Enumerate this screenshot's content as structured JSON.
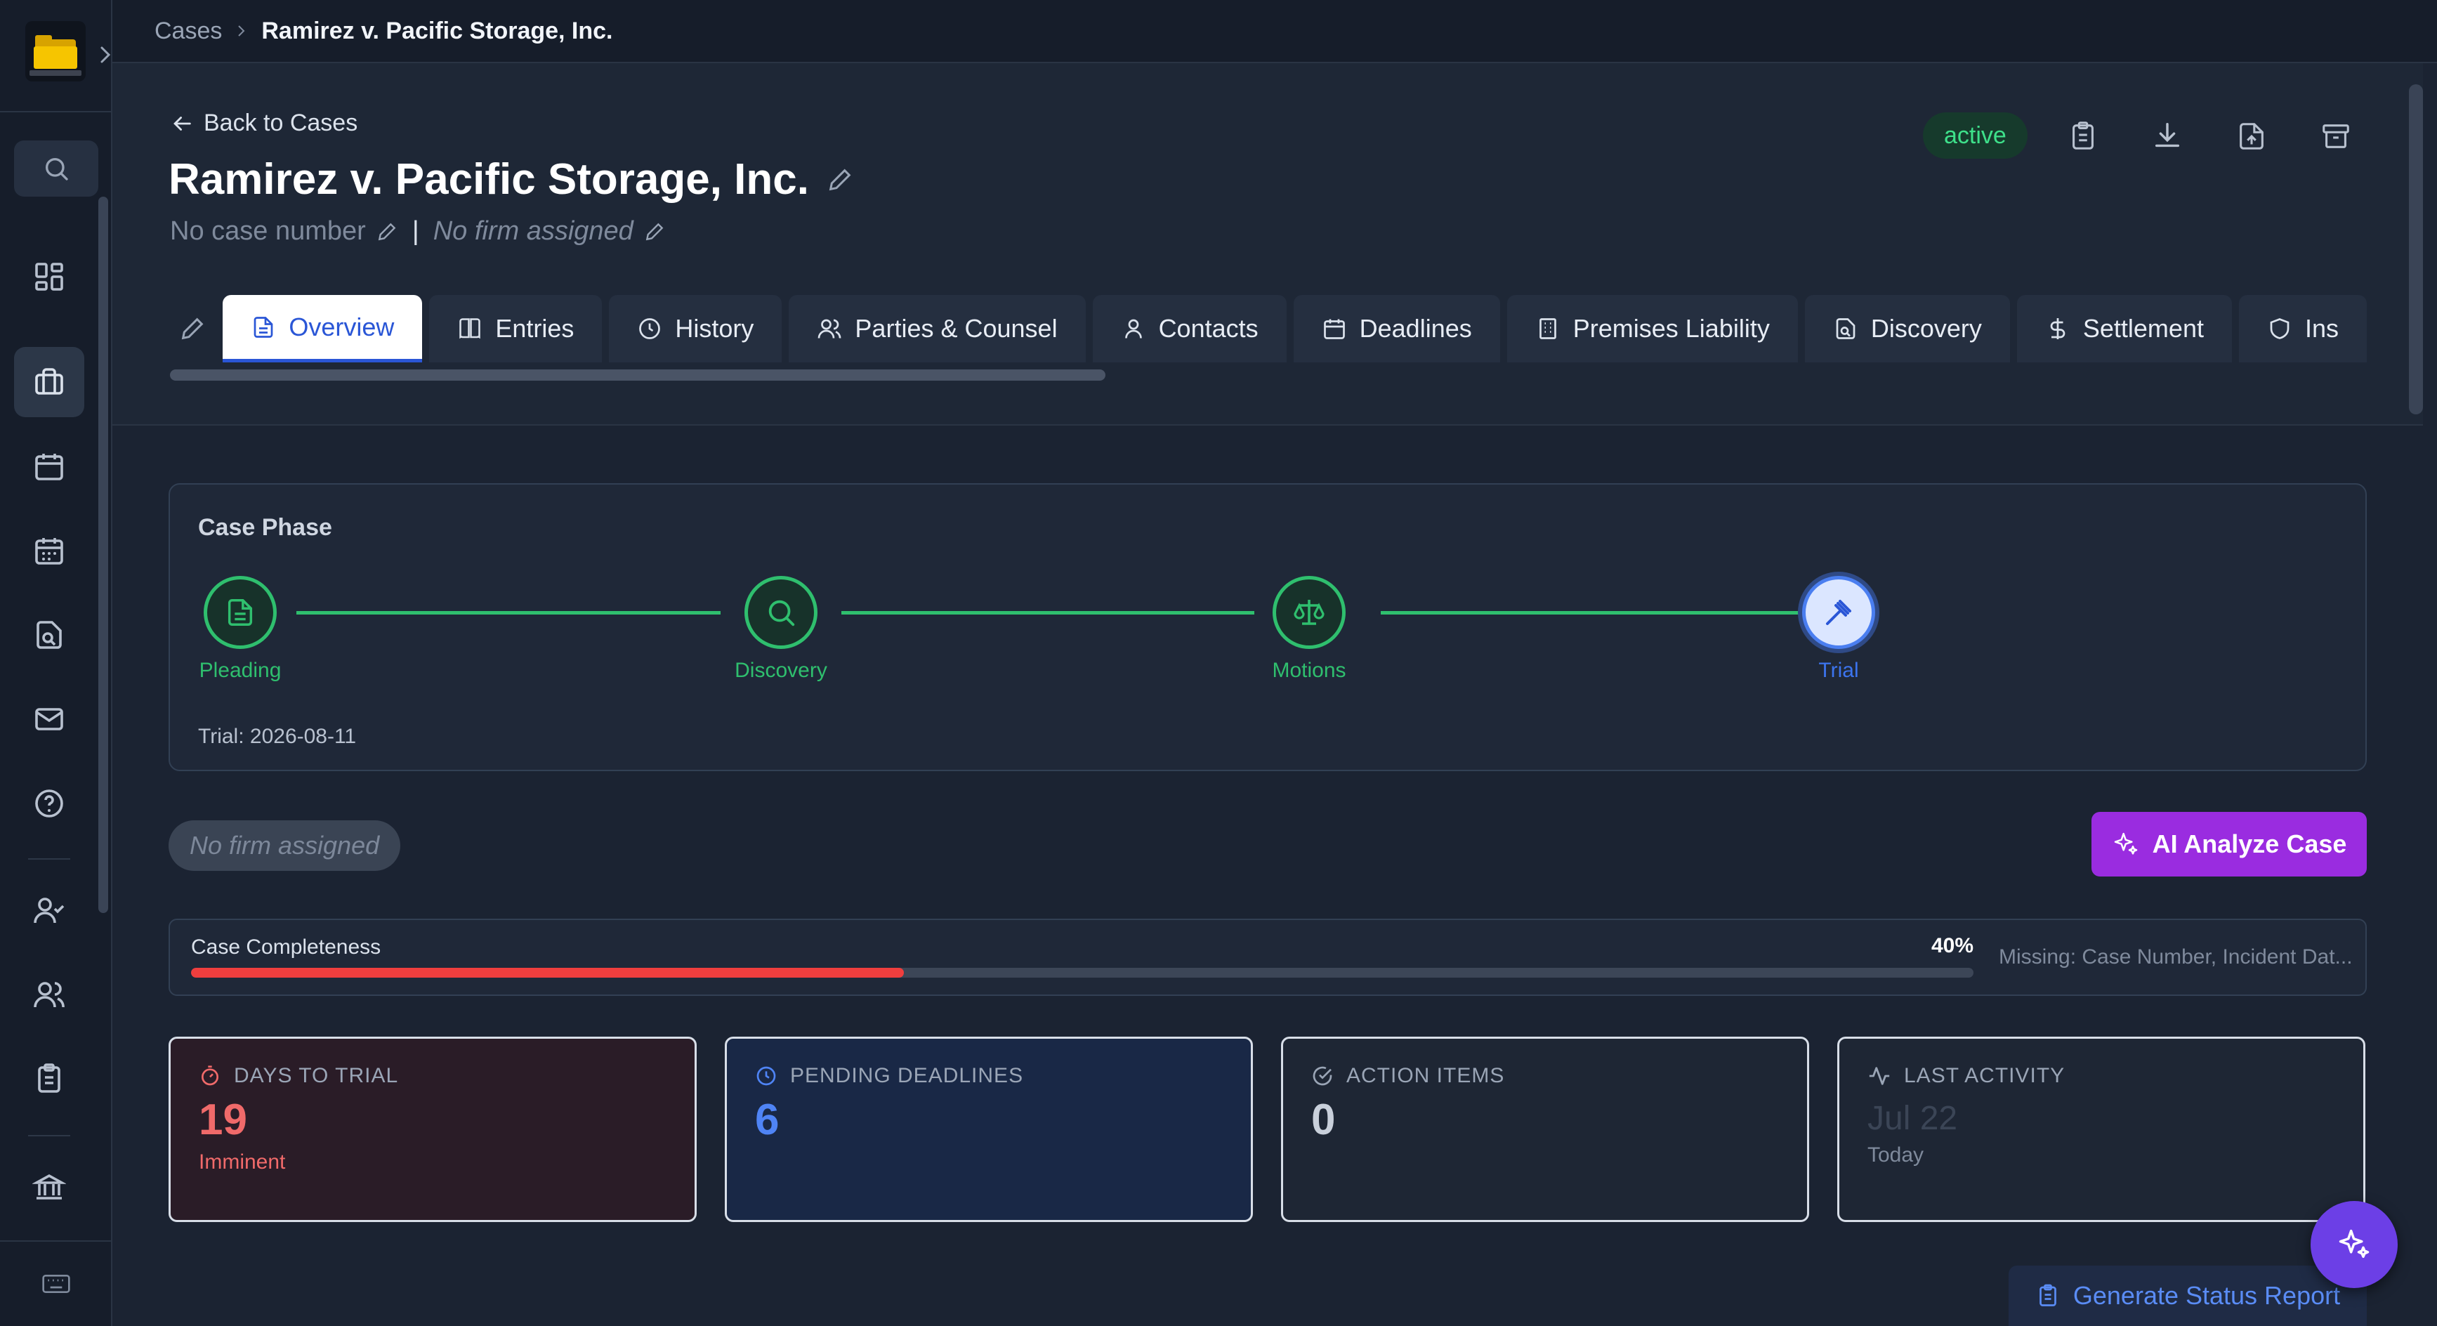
{
  "breadcrumb": {
    "root": "Cases",
    "current": "Ramirez v. Pacific Storage, Inc."
  },
  "header": {
    "back_label": "Back to Cases",
    "title": "Ramirez v. Pacific Storage, Inc.",
    "case_number": "No case number",
    "firm": "No firm assigned",
    "status": "active"
  },
  "tabs": [
    {
      "label": "Overview",
      "icon": "document-icon",
      "active": true
    },
    {
      "label": "Entries",
      "icon": "book-icon"
    },
    {
      "label": "History",
      "icon": "clock-icon"
    },
    {
      "label": "Parties & Counsel",
      "icon": "users-icon"
    },
    {
      "label": "Contacts",
      "icon": "user-icon"
    },
    {
      "label": "Deadlines",
      "icon": "calendar-icon"
    },
    {
      "label": "Premises Liability",
      "icon": "building-icon"
    },
    {
      "label": "Discovery",
      "icon": "file-search-icon"
    },
    {
      "label": "Settlement",
      "icon": "dollar-icon"
    },
    {
      "label": "Ins",
      "icon": "shield-icon"
    }
  ],
  "phase": {
    "title": "Case Phase",
    "steps": [
      {
        "label": "Pleading",
        "icon": "document-icon"
      },
      {
        "label": "Discovery",
        "icon": "search-icon"
      },
      {
        "label": "Motions",
        "icon": "scale-icon"
      },
      {
        "label": "Trial",
        "icon": "gavel-icon",
        "current": true
      }
    ],
    "trial_date": "Trial: 2026-08-11"
  },
  "firm_badge": "No firm assigned",
  "ai_button": "AI Analyze Case",
  "completeness": {
    "label": "Case Completeness",
    "percent_label": "40%",
    "percent": 40,
    "missing": "Missing: Case Number, Incident Dat..."
  },
  "stats": {
    "days": {
      "label": "DAYS TO TRIAL",
      "value": "19",
      "sub": "Imminent"
    },
    "pending": {
      "label": "PENDING DEADLINES",
      "value": "6"
    },
    "actions": {
      "label": "ACTION ITEMS",
      "value": "0"
    },
    "activity": {
      "label": "LAST ACTIVITY",
      "value": "Jul 22",
      "sub": "Today"
    }
  },
  "report_button": "Generate Status Report",
  "colors": {
    "accent": "#2a56d6",
    "success": "#2fbf6e",
    "danger": "#ef3e3e",
    "ai_purple": "#9a2ce0"
  }
}
